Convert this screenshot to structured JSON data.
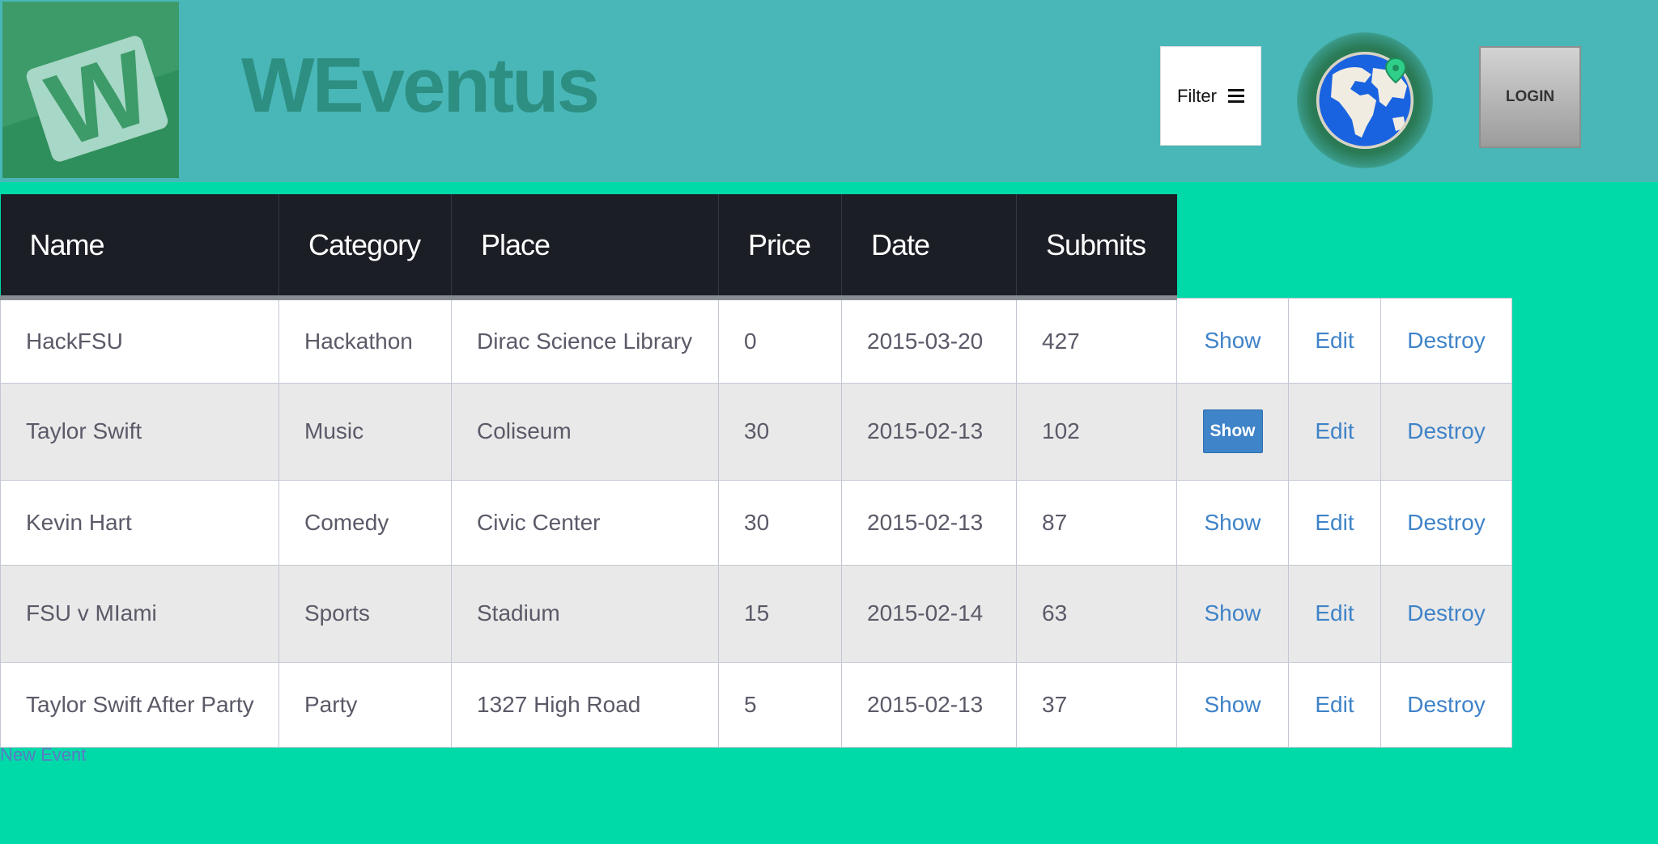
{
  "header": {
    "logo_letter": "W",
    "brand": "WEventus",
    "filter_label": "Filter",
    "login_label": "LOGIN"
  },
  "table": {
    "columns": [
      "Name",
      "Category",
      "Place",
      "Price",
      "Date",
      "Submits"
    ],
    "actions": [
      "Show",
      "Edit",
      "Destroy"
    ],
    "rows": [
      [
        "HackFSU",
        "Hackathon",
        "Dirac Science Library",
        "0",
        "2015-03-20",
        "427"
      ],
      [
        "Taylor Swift",
        "Music",
        "Coliseum",
        "30",
        "2015-02-13",
        "102"
      ],
      [
        "Kevin Hart",
        "Comedy",
        "Civic Center",
        "30",
        "2015-02-13",
        "87"
      ],
      [
        "FSU v MIami",
        "Sports",
        "Stadium",
        "15",
        "2015-02-14",
        "63"
      ],
      [
        "Taylor Swift After Party",
        "Party",
        "1327 High Road",
        "5",
        "2015-02-13",
        "37"
      ]
    ]
  },
  "new_event_link": "New Event",
  "colors": {
    "page_bg": "#00d9a8",
    "header_bg": "#49b7b7",
    "table_head_bg": "#1c1e26",
    "link": "#3f83c8"
  },
  "icons": [
    "w-logo-icon",
    "menu-icon",
    "globe-icon"
  ]
}
